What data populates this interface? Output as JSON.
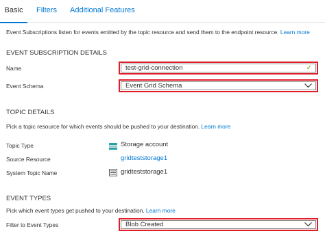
{
  "tabs": [
    {
      "label": "Basic"
    },
    {
      "label": "Filters"
    },
    {
      "label": "Additional Features"
    }
  ],
  "intro": {
    "text": "Event Subscriptions listen for events emitted by the topic resource and send them to the endpoint resource.",
    "link": "Learn more"
  },
  "subscription_details": {
    "heading": "EVENT SUBSCRIPTION DETAILS",
    "name_label": "Name",
    "name_value": "test-grid-connection",
    "schema_label": "Event Schema",
    "schema_value": "Event Grid Schema"
  },
  "topic_details": {
    "heading": "TOPIC DETAILS",
    "desc": "Pick a topic resource for which events should be pushed to your destination.",
    "link": "Learn more",
    "topic_type_label": "Topic Type",
    "topic_type_value": "Storage account",
    "source_resource_label": "Source Resource",
    "source_resource_value": "gridteststorage1",
    "system_topic_label": "System Topic Name",
    "system_topic_value": "gridteststorage1"
  },
  "event_types": {
    "heading": "EVENT TYPES",
    "desc": "Pick which event types get pushed to your destination.",
    "link": "Learn more",
    "filter_label": "Filter to Event Types",
    "filter_value": "Blob Created"
  },
  "colors": {
    "accent": "#0078d4",
    "highlight_border": "#e11d2a",
    "valid_check": "#57a300"
  }
}
